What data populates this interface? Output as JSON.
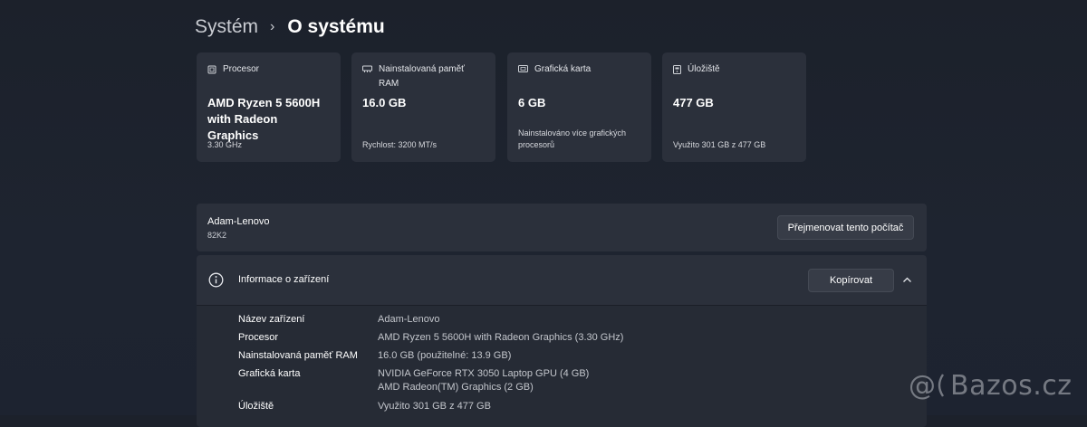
{
  "breadcrumb": {
    "parent": "Systém",
    "separator": "›",
    "current": "O systému"
  },
  "cards": [
    {
      "label": "Procesor",
      "value": "AMD Ryzen 5 5600H with Radeon Graphics",
      "sub": "3.30 GHz",
      "icon": "processor-icon"
    },
    {
      "label": "Nainstalovaná paměť RAM",
      "value": "16.0 GB",
      "sub": "Rychlost: 3200 MT/s",
      "icon": "ram-icon"
    },
    {
      "label": "Grafická karta",
      "value": "6 GB",
      "sub": "Nainstalováno více grafických procesorů",
      "icon": "gpu-icon"
    },
    {
      "label": "Úložiště",
      "value": "477 GB",
      "sub": "Využito 301 GB z 477 GB",
      "icon": "storage-icon"
    }
  ],
  "device": {
    "name": "Adam-Lenovo",
    "model": "82K2",
    "rename_label": "Přejmenovat tento počítač"
  },
  "info": {
    "title": "Informace o zařízení",
    "copy_label": "Kopírovat",
    "rows": [
      {
        "label": "Název zařízení",
        "value": "Adam-Lenovo",
        "value2": ""
      },
      {
        "label": "Procesor",
        "value": "AMD Ryzen 5 5600H with Radeon Graphics (3.30 GHz)",
        "value2": ""
      },
      {
        "label": "Nainstalovaná paměť RAM",
        "value": "16.0 GB (použitelné: 13.9 GB)",
        "value2": ""
      },
      {
        "label": "Grafická karta",
        "value": "NVIDIA GeForce RTX 3050 Laptop GPU (4 GB)",
        "value2": "AMD Radeon(TM) Graphics (2 GB)"
      },
      {
        "label": "Úložiště",
        "value": "Využito 301 GB z 477 GB",
        "value2": ""
      }
    ]
  },
  "watermark": {
    "text": "Bazos.cz"
  }
}
